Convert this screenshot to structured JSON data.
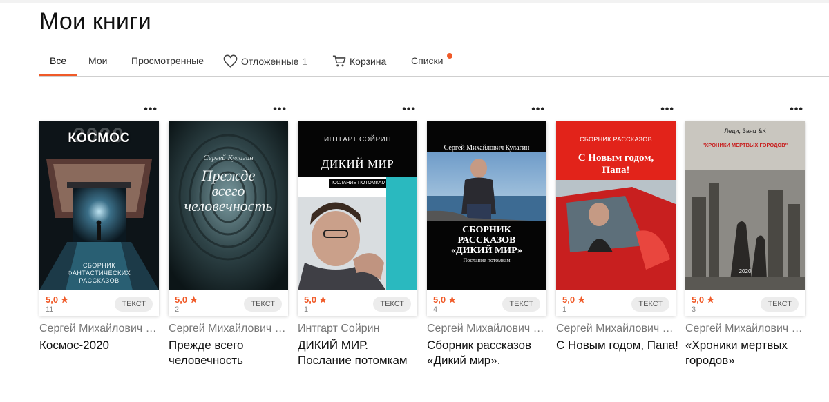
{
  "page": {
    "title": "Мои книги"
  },
  "tabs": [
    {
      "label": "Все",
      "active": true
    },
    {
      "label": "Мои"
    },
    {
      "label": "Просмотренные"
    },
    {
      "label": "Отложенные",
      "count": "1",
      "icon": "heart-icon"
    },
    {
      "label": "Корзина",
      "icon": "cart-icon"
    },
    {
      "label": "Списки",
      "indicator": "notification-dot"
    }
  ],
  "colors": {
    "accent": "#f05a28",
    "divider": "#cfcfcf"
  },
  "books": [
    {
      "author": "Сергей Михайлович Кулагин",
      "title": "Космос-2020",
      "rating": "5,0",
      "rating_count": "11",
      "type": "ТЕКСТ",
      "more": "•••",
      "cover": {
        "top": "КОСМОС",
        "big": "2020",
        "bottom": "СБОРНИК ФАНТАСТИЧЕСКИХ РАССКАЗОВ"
      }
    },
    {
      "author": "Сергей Михайлович Кулагин",
      "title": "Прежде всего человечность",
      "rating": "5,0",
      "rating_count": "2",
      "type": "ТЕКСТ",
      "more": "•••",
      "cover": {
        "author": "Сергей Кулагин",
        "line1": "Прежде",
        "line2": "всего",
        "line3": "человечность"
      }
    },
    {
      "author": "Интгарт Сойрин",
      "title": "ДИКИЙ МИР. Послание потомкам",
      "rating": "5,0",
      "rating_count": "1",
      "type": "ТЕКСТ",
      "more": "•••",
      "cover": {
        "author": "ИНТГАРТ СОЙРИН",
        "title": "ДИКИЙ МИР",
        "subtitle": "ПОСЛАНИЕ ПОТОМКАМ"
      }
    },
    {
      "author": "Сергей Михайлович Кулагин",
      "title": "Сборник рассказов «Дикий мир». Послание потомкам",
      "rating": "5,0",
      "rating_count": "4",
      "type": "ТЕКСТ",
      "more": "•••",
      "cover": {
        "author": "Сергей Михайлович Кулагин",
        "line1": "СБОРНИК",
        "line2": "РАССКАЗОВ",
        "line3": "«ДИКИЙ МИР»",
        "subtitle": "Послание потомкам"
      }
    },
    {
      "author": "Сергей Михайлович Кулагин",
      "title": "С Новым годом, Папа!",
      "rating": "5,0",
      "rating_count": "1",
      "type": "ТЕКСТ",
      "more": "•••",
      "cover": {
        "header": "СБОРНИК РАССКАЗОВ",
        "line1": "С Новым годом,",
        "line2": "Папа!"
      }
    },
    {
      "author": "Сергей Михайлович Кулагин",
      "title": "«Хроники мертвых городов»",
      "rating": "5,0",
      "rating_count": "3",
      "type": "ТЕКСТ",
      "more": "•••",
      "cover": {
        "top": "Леди, Заяц &К",
        "title": "\"ХРОНИКИ МЕРТВЫХ ГОРОДОВ\"",
        "year": "2020"
      }
    }
  ]
}
